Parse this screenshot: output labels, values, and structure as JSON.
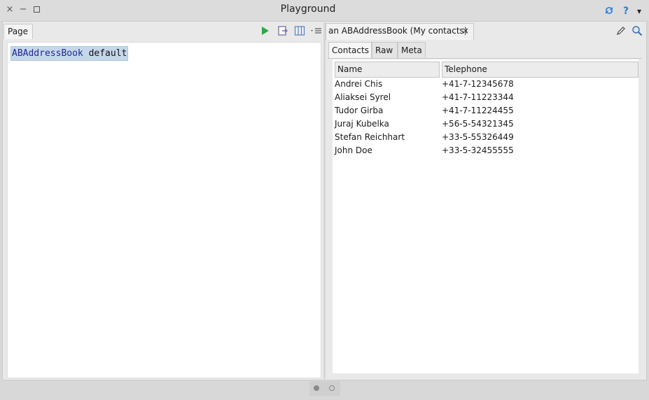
{
  "window": {
    "title": "Playground",
    "close_glyph": "×",
    "minimize_glyph": "−",
    "maximize_glyph": "□",
    "help_glyph": "?",
    "menu_glyph": "▾"
  },
  "left": {
    "tab_label": "Page",
    "code_class": "ABAddressBook",
    "code_selector": " default",
    "toolbar": {
      "run_icon": "play-icon",
      "inspect_icon": "inspect-icon",
      "bindings_icon": "bindings-icon",
      "menu_icon": "menu-icon"
    }
  },
  "right": {
    "tab_label": "an ABAddressBook (My contacts)",
    "close_glyph": "×",
    "subtabs": [
      "Contacts",
      "Raw",
      "Meta"
    ],
    "active_subtab": "Contacts",
    "columns": [
      "Name",
      "Telephone"
    ],
    "rows": [
      {
        "name": "Andrei Chis",
        "telephone": "+41-7-12345678"
      },
      {
        "name": "Aliaksei Syrel",
        "telephone": "+41-7-11223344"
      },
      {
        "name": "Tudor Girba",
        "telephone": "+41-7-11224455"
      },
      {
        "name": "Juraj Kubelka",
        "telephone": "+56-5-54321345"
      },
      {
        "name": "Stefan Reichhart",
        "telephone": "+33-5-55326449"
      },
      {
        "name": "John Doe",
        "telephone": "+33-5-32455555"
      }
    ]
  },
  "colors": {
    "accent_blue": "#2a7fd6",
    "run_green": "#2da84a",
    "selection": "#c5d7ea"
  },
  "pager": {
    "pages": 2,
    "current": 1
  }
}
